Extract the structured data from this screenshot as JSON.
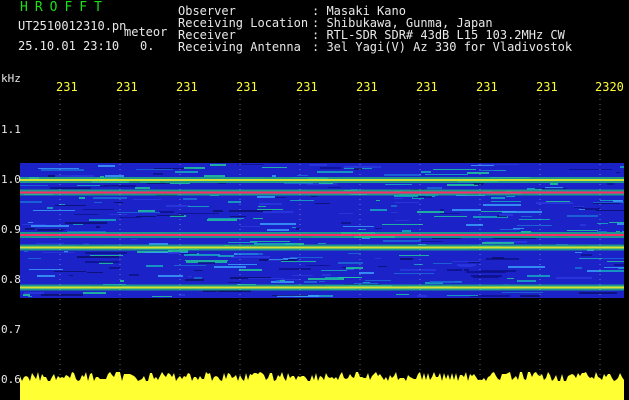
{
  "header": {
    "brand": "HROFFT",
    "filename": "UT2510012310.pn",
    "meteor_label": "meteor",
    "datetime": "25.10.01 23:10",
    "count": "0.",
    "fields": [
      {
        "label": "Observer",
        "value": ": Masaki Kano"
      },
      {
        "label": "Receiving Location",
        "value": ": Shibukawa, Gunma, Japan"
      },
      {
        "label": "Receiver",
        "value": ": RTL-SDR SDR# 43dB L15 103.2MHz CW"
      },
      {
        "label": "Receiving Antenna",
        "value": ": 3el Yagi(V) Az 330 for Vladivostok"
      }
    ]
  },
  "axis": {
    "unit": "kHz",
    "time_ticks": [
      "231",
      "231",
      "231",
      "231",
      "231",
      "231",
      "231",
      "231",
      "231",
      "2320"
    ],
    "freq_ticks": [
      "1.1",
      "1.0",
      "0.9",
      "0.8",
      "0.7",
      "0.6"
    ]
  },
  "spectrogram": {
    "background": "#000000",
    "noise_color": "#1a22c8",
    "signal_bands_khz": [
      1.0,
      0.975,
      0.89,
      0.865,
      0.785
    ],
    "grid_color": "#d0d0d0",
    "amplitude_color": "#ffff33"
  }
}
